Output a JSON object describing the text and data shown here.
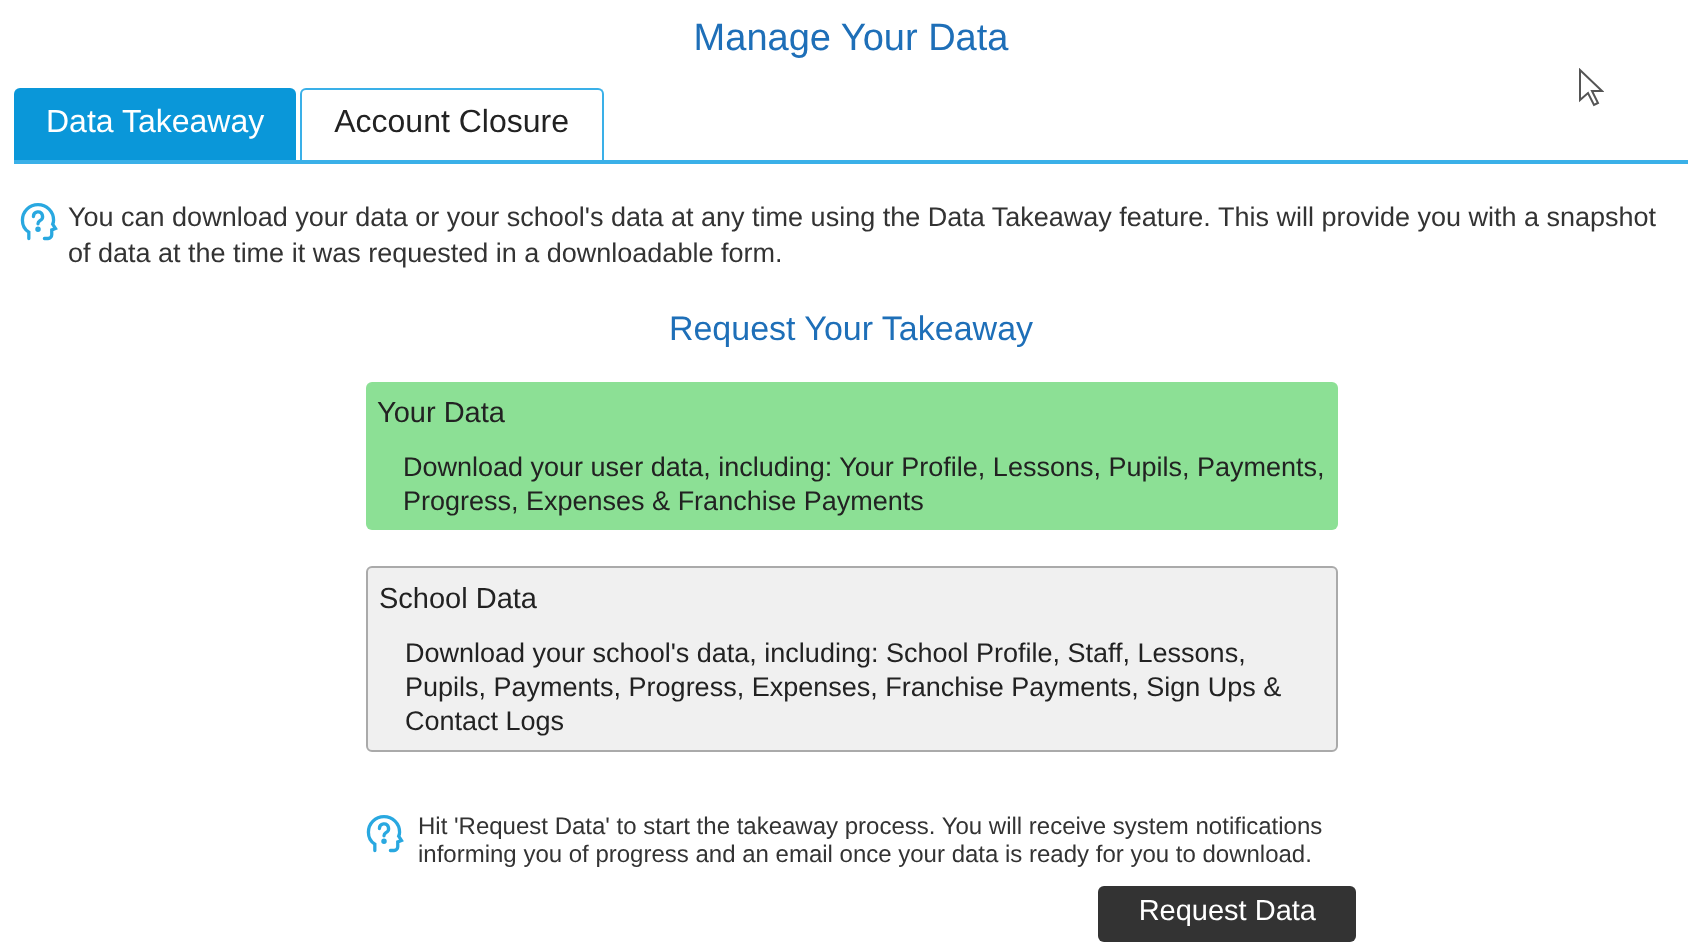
{
  "title": "Manage Your Data",
  "tabs": [
    {
      "label": "Data Takeaway",
      "selected": true
    },
    {
      "label": "Account Closure",
      "selected": false
    }
  ],
  "intro": "You can download your data or your school's data at any time using the Data Takeaway feature. This will provide you with a snapshot of data at the time it was requested in a downloadable form.",
  "section_title": "Request Your Takeaway",
  "options": [
    {
      "title": "Your Data",
      "description": "Download your user data, including: Your Profile, Lessons, Pupils, Payments, Progress, Expenses & Franchise Payments",
      "selected": true
    },
    {
      "title": "School Data",
      "description": "Download your school's data, including: School Profile, Staff, Lessons, Pupils, Payments, Progress, Expenses, Franchise Payments, Sign Ups & Contact Logs",
      "selected": false
    }
  ],
  "hint": "Hit 'Request Data' to start the takeaway process. You will receive system notifications informing you of progress and an email once your data is ready for you to download.",
  "button": "Request Data"
}
